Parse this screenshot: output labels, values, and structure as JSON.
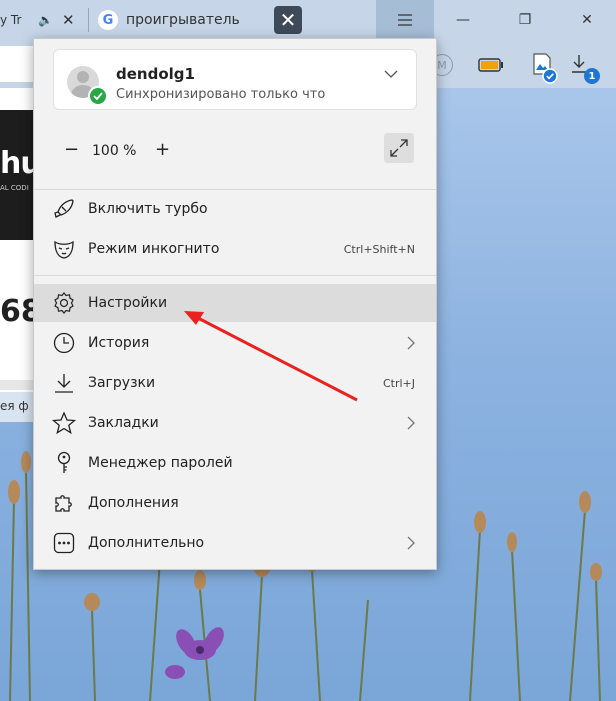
{
  "tabs": [
    {
      "title": "y Tr",
      "speaker": "🔈",
      "close": "✕"
    },
    {
      "favicon_letter": "G",
      "title": "проигрыватель"
    }
  ],
  "active_tab_close": "✕",
  "window_controls": {
    "minimize": "—",
    "maximize": "❐",
    "close": "✕"
  },
  "toolbar": {
    "m_badge": "M",
    "downloads_count": "1"
  },
  "webpage": {
    "logo_text": "hul",
    "logo_sub": "AL CODI",
    "number": "68",
    "side_text": "ея ф"
  },
  "menu": {
    "profile": {
      "username": "dendolg1",
      "status": "Синхронизировано только что"
    },
    "zoom": {
      "minus": "−",
      "value": "100 %",
      "plus": "+"
    },
    "items": [
      {
        "label": "Включить турбо",
        "icon": "rocket-icon"
      },
      {
        "label": "Режим инкогнито",
        "icon": "incognito-mask-icon",
        "shortcut": "Ctrl+Shift+N"
      },
      {
        "label": "Настройки",
        "icon": "gear-icon",
        "highlighted": true
      },
      {
        "label": "История",
        "icon": "clock-icon",
        "submenu": true
      },
      {
        "label": "Загрузки",
        "icon": "download-icon",
        "shortcut": "Ctrl+J"
      },
      {
        "label": "Закладки",
        "icon": "star-icon",
        "submenu": true
      },
      {
        "label": "Менеджер паролей",
        "icon": "key-icon"
      },
      {
        "label": "Дополнения",
        "icon": "puzzle-icon"
      },
      {
        "label": "Дополнительно",
        "icon": "more-dots-icon",
        "submenu": true
      }
    ]
  },
  "colors": {
    "highlight": "#dcdcdc",
    "check": "#27a844",
    "annotation_arrow": "#e8231f",
    "badge": "#1e77d4"
  }
}
